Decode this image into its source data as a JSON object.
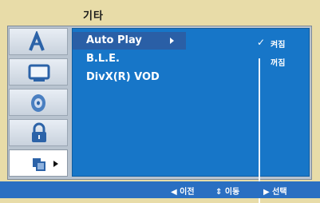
{
  "header": {
    "title": "기타"
  },
  "sidebar": {
    "tiles": [
      {
        "icon": "language-icon"
      },
      {
        "icon": "display-icon"
      },
      {
        "icon": "audio-icon"
      },
      {
        "icon": "lock-icon"
      },
      {
        "icon": "others-icon",
        "active": true
      }
    ]
  },
  "menu": {
    "items": [
      {
        "label": "Auto Play"
      },
      {
        "label": "B.L.E."
      },
      {
        "label": "DivX(R) VOD"
      }
    ]
  },
  "options": {
    "on": "켜짐",
    "off": "꺼짐",
    "selected": "켜짐"
  },
  "footer": {
    "prev": "◀ 이전",
    "move": "⇕ 이동",
    "select": "▶ 선택"
  },
  "colors": {
    "background": "#e8dca8",
    "panel": "#1776c8",
    "footer": "#2a6fc2",
    "selection": "#2a5fa6"
  }
}
